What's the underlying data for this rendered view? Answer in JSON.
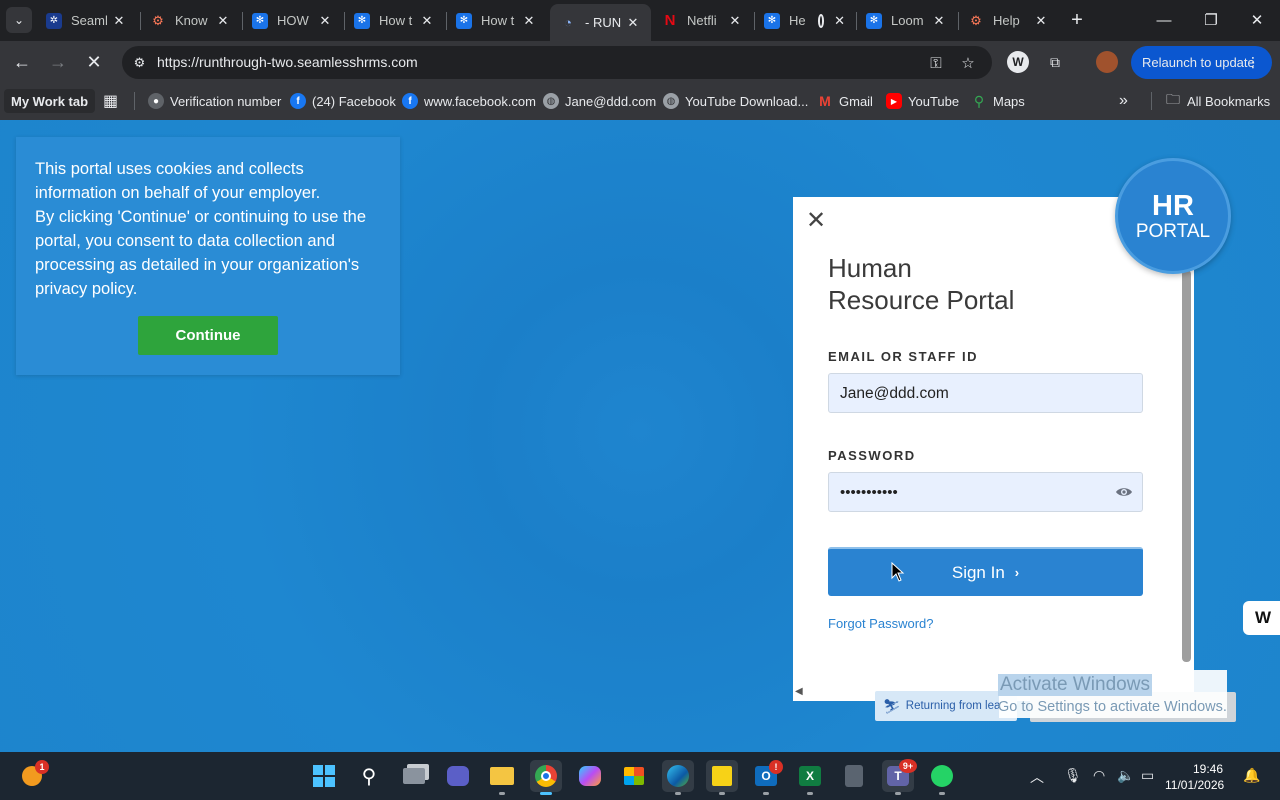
{
  "browser": {
    "tabs": [
      {
        "title": "Seaml",
        "favicon": "seamless-icon"
      },
      {
        "title": "Know",
        "favicon": "hubspot-icon"
      },
      {
        "title": "HOW",
        "favicon": "gear-app-icon"
      },
      {
        "title": "How t",
        "favicon": "gear-app-icon"
      },
      {
        "title": "How t",
        "favicon": "gear-app-icon"
      },
      {
        "title": "- RUN",
        "favicon": "run-icon"
      },
      {
        "title": "Netfli",
        "favicon": "netflix-icon"
      },
      {
        "title": "He",
        "favicon": "gear-app-icon"
      },
      {
        "title": "Loom",
        "favicon": "gear-app-icon"
      },
      {
        "title": "Help",
        "favicon": "hubspot-icon"
      }
    ],
    "active_tab_index": 5,
    "url": "https://runthrough-two.seamlesshrms.com",
    "relaunch_label": "Relaunch to update",
    "bookmarks": [
      {
        "label": "My Work tab",
        "icon": ""
      },
      {
        "label": "Verification number",
        "icon": "person-icon"
      },
      {
        "label": "(24) Facebook",
        "icon": "facebook-icon"
      },
      {
        "label": "www.facebook.com",
        "icon": "facebook-icon"
      },
      {
        "label": "Jane@ddd.com",
        "icon": "globe-icon"
      },
      {
        "label": "YouTube Download...",
        "icon": "globe-icon"
      },
      {
        "label": "Gmail",
        "icon": "gmail-icon"
      },
      {
        "label": "YouTube",
        "icon": "youtube-icon"
      },
      {
        "label": "Maps",
        "icon": "maps-icon"
      }
    ],
    "all_bookmarks_label": "All Bookmarks"
  },
  "cookie_notice": {
    "text": "This portal uses cookies and collects information on behalf of your employer.\nBy clicking 'Continue' or continuing to use the portal, you consent to data collection and processing as detailed in your organization's privacy policy.",
    "button_label": "Continue"
  },
  "login": {
    "title_line1": "Human",
    "title_line2": "Resource Portal",
    "badge_big": "HR",
    "badge_small": "PORTAL",
    "email_label": "EMAIL OR STAFF ID",
    "email_value": "Jane@ddd.com",
    "password_label": "PASSWORD",
    "password_value": "•••••••••••",
    "signin_label": "Sign In",
    "forgot_label": "Forgot Password?",
    "close_symbol": "✕"
  },
  "overlays": {
    "returning_label": "Returning from lea",
    "activate_title": "Activate Windows",
    "activate_sub": "Go to Settings to activate Windows.",
    "side_widget": "W"
  },
  "taskbar": {
    "time": "19:46",
    "date": "11/01/2026",
    "notification_badge": "1",
    "outlook_badge": "!",
    "teams_badge": "9+"
  },
  "colors": {
    "page_bg": "#1d84cc",
    "primary": "#2a83d1",
    "continue_green": "#2ea43c"
  }
}
